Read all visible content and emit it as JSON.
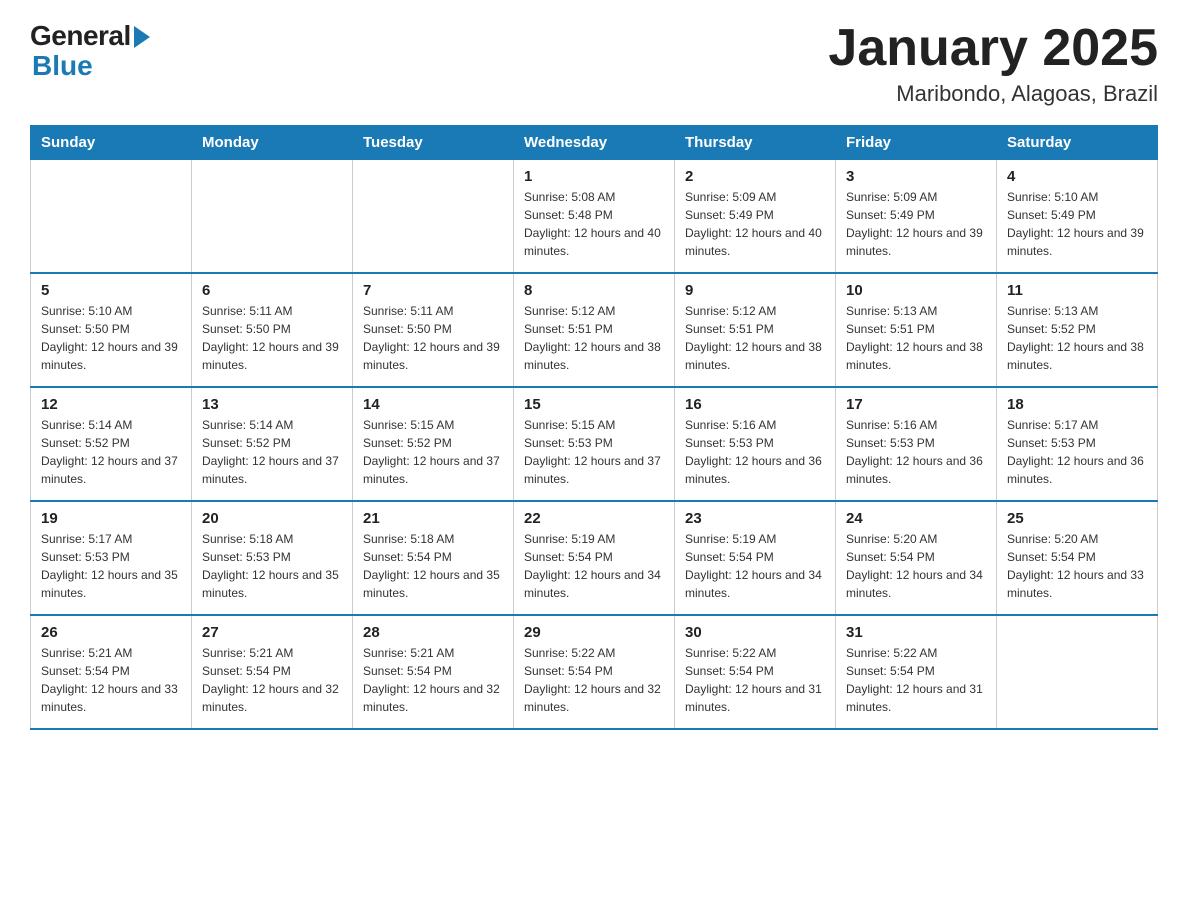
{
  "header": {
    "logo_general": "General",
    "logo_blue": "Blue",
    "title": "January 2025",
    "subtitle": "Maribondo, Alagoas, Brazil"
  },
  "calendar": {
    "days_of_week": [
      "Sunday",
      "Monday",
      "Tuesday",
      "Wednesday",
      "Thursday",
      "Friday",
      "Saturday"
    ],
    "weeks": [
      [
        {
          "day": "",
          "info": ""
        },
        {
          "day": "",
          "info": ""
        },
        {
          "day": "",
          "info": ""
        },
        {
          "day": "1",
          "info": "Sunrise: 5:08 AM\nSunset: 5:48 PM\nDaylight: 12 hours and 40 minutes."
        },
        {
          "day": "2",
          "info": "Sunrise: 5:09 AM\nSunset: 5:49 PM\nDaylight: 12 hours and 40 minutes."
        },
        {
          "day": "3",
          "info": "Sunrise: 5:09 AM\nSunset: 5:49 PM\nDaylight: 12 hours and 39 minutes."
        },
        {
          "day": "4",
          "info": "Sunrise: 5:10 AM\nSunset: 5:49 PM\nDaylight: 12 hours and 39 minutes."
        }
      ],
      [
        {
          "day": "5",
          "info": "Sunrise: 5:10 AM\nSunset: 5:50 PM\nDaylight: 12 hours and 39 minutes."
        },
        {
          "day": "6",
          "info": "Sunrise: 5:11 AM\nSunset: 5:50 PM\nDaylight: 12 hours and 39 minutes."
        },
        {
          "day": "7",
          "info": "Sunrise: 5:11 AM\nSunset: 5:50 PM\nDaylight: 12 hours and 39 minutes."
        },
        {
          "day": "8",
          "info": "Sunrise: 5:12 AM\nSunset: 5:51 PM\nDaylight: 12 hours and 38 minutes."
        },
        {
          "day": "9",
          "info": "Sunrise: 5:12 AM\nSunset: 5:51 PM\nDaylight: 12 hours and 38 minutes."
        },
        {
          "day": "10",
          "info": "Sunrise: 5:13 AM\nSunset: 5:51 PM\nDaylight: 12 hours and 38 minutes."
        },
        {
          "day": "11",
          "info": "Sunrise: 5:13 AM\nSunset: 5:52 PM\nDaylight: 12 hours and 38 minutes."
        }
      ],
      [
        {
          "day": "12",
          "info": "Sunrise: 5:14 AM\nSunset: 5:52 PM\nDaylight: 12 hours and 37 minutes."
        },
        {
          "day": "13",
          "info": "Sunrise: 5:14 AM\nSunset: 5:52 PM\nDaylight: 12 hours and 37 minutes."
        },
        {
          "day": "14",
          "info": "Sunrise: 5:15 AM\nSunset: 5:52 PM\nDaylight: 12 hours and 37 minutes."
        },
        {
          "day": "15",
          "info": "Sunrise: 5:15 AM\nSunset: 5:53 PM\nDaylight: 12 hours and 37 minutes."
        },
        {
          "day": "16",
          "info": "Sunrise: 5:16 AM\nSunset: 5:53 PM\nDaylight: 12 hours and 36 minutes."
        },
        {
          "day": "17",
          "info": "Sunrise: 5:16 AM\nSunset: 5:53 PM\nDaylight: 12 hours and 36 minutes."
        },
        {
          "day": "18",
          "info": "Sunrise: 5:17 AM\nSunset: 5:53 PM\nDaylight: 12 hours and 36 minutes."
        }
      ],
      [
        {
          "day": "19",
          "info": "Sunrise: 5:17 AM\nSunset: 5:53 PM\nDaylight: 12 hours and 35 minutes."
        },
        {
          "day": "20",
          "info": "Sunrise: 5:18 AM\nSunset: 5:53 PM\nDaylight: 12 hours and 35 minutes."
        },
        {
          "day": "21",
          "info": "Sunrise: 5:18 AM\nSunset: 5:54 PM\nDaylight: 12 hours and 35 minutes."
        },
        {
          "day": "22",
          "info": "Sunrise: 5:19 AM\nSunset: 5:54 PM\nDaylight: 12 hours and 34 minutes."
        },
        {
          "day": "23",
          "info": "Sunrise: 5:19 AM\nSunset: 5:54 PM\nDaylight: 12 hours and 34 minutes."
        },
        {
          "day": "24",
          "info": "Sunrise: 5:20 AM\nSunset: 5:54 PM\nDaylight: 12 hours and 34 minutes."
        },
        {
          "day": "25",
          "info": "Sunrise: 5:20 AM\nSunset: 5:54 PM\nDaylight: 12 hours and 33 minutes."
        }
      ],
      [
        {
          "day": "26",
          "info": "Sunrise: 5:21 AM\nSunset: 5:54 PM\nDaylight: 12 hours and 33 minutes."
        },
        {
          "day": "27",
          "info": "Sunrise: 5:21 AM\nSunset: 5:54 PM\nDaylight: 12 hours and 32 minutes."
        },
        {
          "day": "28",
          "info": "Sunrise: 5:21 AM\nSunset: 5:54 PM\nDaylight: 12 hours and 32 minutes."
        },
        {
          "day": "29",
          "info": "Sunrise: 5:22 AM\nSunset: 5:54 PM\nDaylight: 12 hours and 32 minutes."
        },
        {
          "day": "30",
          "info": "Sunrise: 5:22 AM\nSunset: 5:54 PM\nDaylight: 12 hours and 31 minutes."
        },
        {
          "day": "31",
          "info": "Sunrise: 5:22 AM\nSunset: 5:54 PM\nDaylight: 12 hours and 31 minutes."
        },
        {
          "day": "",
          "info": ""
        }
      ]
    ]
  }
}
